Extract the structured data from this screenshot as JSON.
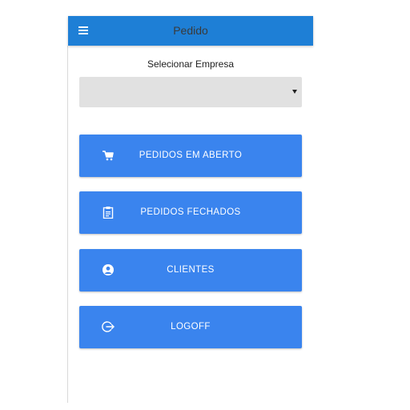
{
  "toolbar": {
    "title": "Pedido",
    "menu_icon": "hamburger-menu-icon"
  },
  "company_select": {
    "label": "Selecionar Empresa",
    "value": ""
  },
  "menu": {
    "items": [
      {
        "label": "PEDIDOS EM ABERTO",
        "icon": "shopping-cart-icon"
      },
      {
        "label": "PEDIDOS FECHADOS",
        "icon": "clipboard-icon"
      },
      {
        "label": "CLIENTES",
        "icon": "user-icon"
      },
      {
        "label": "LOGOFF",
        "icon": "logout-icon"
      }
    ]
  },
  "colors": {
    "toolbar": "#1e7fd6",
    "button": "#3a84ee",
    "select_background": "#e1e1e1",
    "button_text": "#ffffff"
  }
}
